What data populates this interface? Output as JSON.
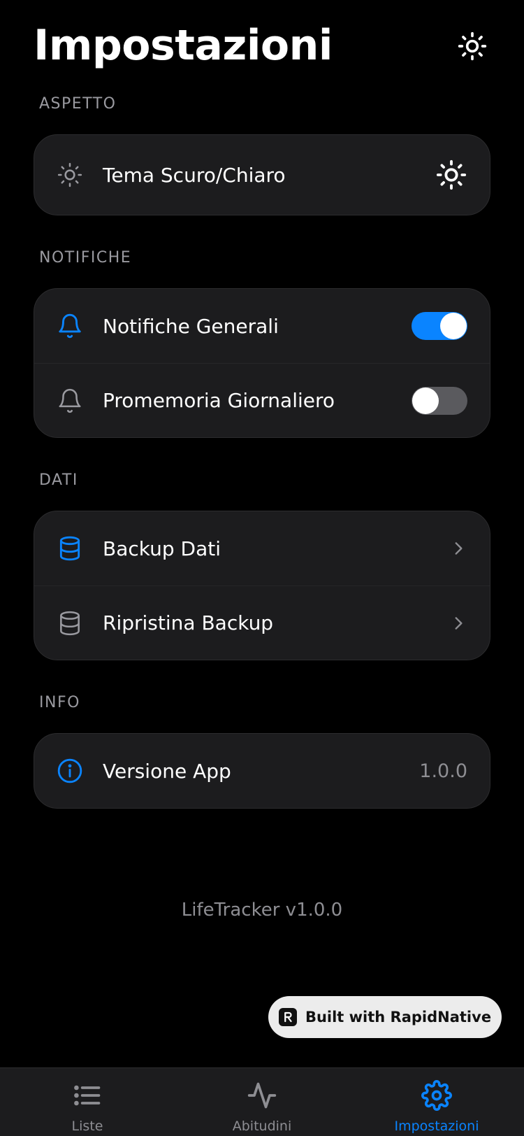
{
  "header": {
    "title": "Impostazioni",
    "theme_icon": "sun-icon"
  },
  "sections": {
    "aspetto": {
      "label": "ASPETTO",
      "rows": [
        {
          "label": "Tema Scuro/Chiaro",
          "icon": "sun-icon",
          "right_icon": "sun-icon"
        }
      ]
    },
    "notifiche": {
      "label": "NOTIFICHE",
      "rows": [
        {
          "label": "Notifiche Generali",
          "icon": "bell-icon",
          "toggle": "on"
        },
        {
          "label": "Promemoria Giornaliero",
          "icon": "bell-icon",
          "toggle": "off"
        }
      ]
    },
    "dati": {
      "label": "DATI",
      "rows": [
        {
          "label": "Backup Dati",
          "icon": "database-icon"
        },
        {
          "label": "Ripristina Backup",
          "icon": "database-icon"
        }
      ]
    },
    "info": {
      "label": "INFO",
      "rows": [
        {
          "label": "Versione App",
          "icon": "info-icon",
          "value": "1.0.0"
        }
      ]
    }
  },
  "footer": {
    "version_text": "LifeTracker v1.0.0"
  },
  "badge": {
    "text": "Built with RapidNative"
  },
  "tabbar": {
    "tabs": [
      {
        "label": "Liste",
        "icon": "list-icon"
      },
      {
        "label": "Abitudini",
        "icon": "activity-icon"
      },
      {
        "label": "Impostazioni",
        "icon": "gear-icon",
        "active": true
      }
    ]
  },
  "colors": {
    "accent": "#0a84ff",
    "background": "#000000",
    "card": "#1c1c1e",
    "muted": "#8e8e93"
  }
}
